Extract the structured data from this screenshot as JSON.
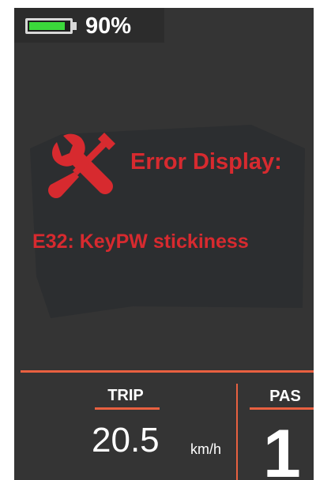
{
  "status_bar": {
    "battery_icon": "battery-icon",
    "battery_level": 0.9,
    "battery_text": "90%",
    "battery_color": "#3bd83b"
  },
  "error": {
    "icon": "tools-icon",
    "title": "Error Display:",
    "message": "E32: KeyPW stickiness",
    "color": "#d72a2f"
  },
  "trip": {
    "label": "TRIP",
    "value": "20.5",
    "unit": "km/h"
  },
  "pas": {
    "label": "PAS",
    "value": "1"
  },
  "colors": {
    "screen_bg": "#343434",
    "accent": "#e86040"
  }
}
